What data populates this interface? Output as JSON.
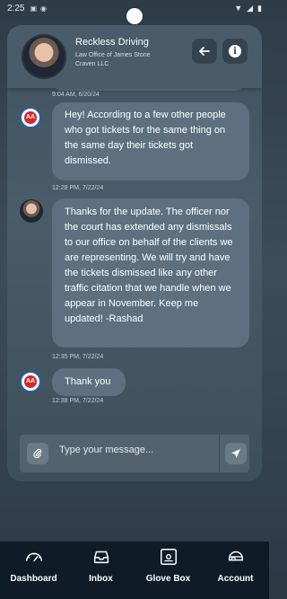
{
  "status_bar": {
    "time": "2:25"
  },
  "header": {
    "contact_name": "Reckless Driving",
    "contact_org": "Law Office of James Stone Craven LLC"
  },
  "messages": [
    {
      "sender": "lawyer",
      "text": "",
      "timestamp": "9:04 AM, 6/20/24"
    },
    {
      "sender": "client",
      "text": "Hey! According to a few other people who got tickets for the same thing on the same day their tickets got dismissed.",
      "timestamp": "12:28 PM, 7/22/24"
    },
    {
      "sender": "lawyer",
      "text": "Thanks for the update. The officer nor the court has extended any dismissals to our office on behalf of the clients we are representing. We will try and have the tickets dismissed like any other traffic citation that we handle when we appear in November. Keep me updated! -Rashad",
      "timestamp": "12:35 PM, 7/22/24"
    },
    {
      "sender": "client",
      "text": "Thank you",
      "timestamp": "12:38 PM, 7/22/24"
    }
  ],
  "composer": {
    "placeholder": "Type your message..."
  },
  "nav": [
    {
      "label": "Dashboard",
      "icon": "gauge-icon"
    },
    {
      "label": "Inbox",
      "icon": "inbox-icon"
    },
    {
      "label": "Glove Box",
      "icon": "glove-box-icon"
    },
    {
      "label": "Account",
      "icon": "account-icon"
    }
  ],
  "colors": {
    "background": "#2e3c48",
    "bubble": "#5e7080",
    "nav_bar": "#0f1c27",
    "logo_red": "#d42a2a",
    "logo_blue": "#2460b0"
  }
}
